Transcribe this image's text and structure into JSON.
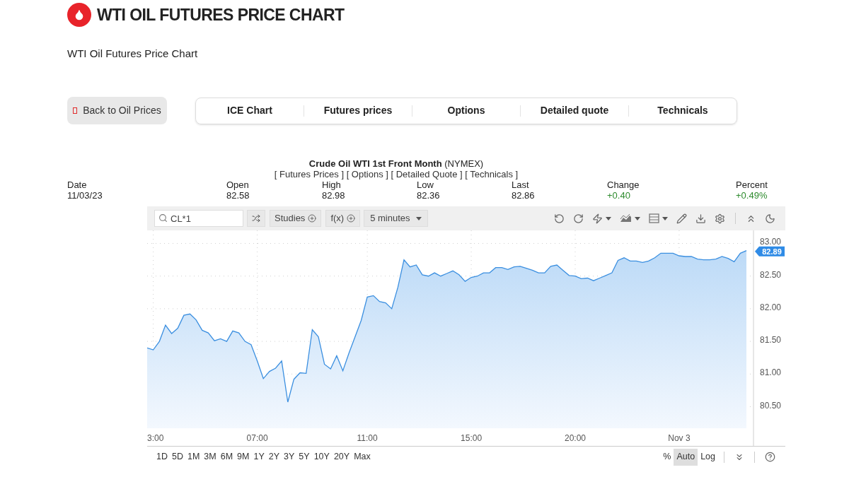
{
  "header": {
    "title": "WTI OIL FUTURES PRICE CHART",
    "subtitle": "WTI Oil Futures Price Chart"
  },
  "back_button": {
    "label": "Back to Oil Prices"
  },
  "nav": [
    "ICE Chart",
    "Futures prices",
    "Options",
    "Detailed quote",
    "Technicals"
  ],
  "quote": {
    "title": "**Crude Oil WTI 1st Front Month** (NYMEX)",
    "links": "[ Futures Prices ] [ Options ] [ Detailed Quote ] [ Technicals ]",
    "stats": [
      {
        "label": "Date",
        "value": "11/03/23"
      },
      {
        "label": "Open",
        "value": "82.58"
      },
      {
        "label": "High",
        "value": "82.98"
      },
      {
        "label": "Low",
        "value": "82.36"
      },
      {
        "label": "Last",
        "value": "82.86"
      },
      {
        "label": "Change",
        "value": "+0.40",
        "color": "#2e8b2e"
      },
      {
        "label": "Percent",
        "value": "+0.49%",
        "color": "#2e8b2e"
      }
    ]
  },
  "toolbar": {
    "search": {
      "value": "CL*1"
    },
    "studies": "Studies",
    "fx": "f(x)",
    "interval": "5 minutes"
  },
  "chart": {
    "last_price": "82.89",
    "chart_data": {
      "type": "area",
      "categories": [
        null,
        "3:00",
        null,
        null,
        null,
        null,
        null,
        null,
        null,
        null,
        null,
        null,
        null,
        null,
        null,
        null,
        null,
        null,
        "07:00",
        null,
        null,
        null,
        null,
        null,
        null,
        null,
        null,
        null,
        null,
        null,
        null,
        null,
        null,
        null,
        null,
        null,
        "11:00",
        null,
        null,
        null,
        null,
        null,
        null,
        null,
        null,
        null,
        null,
        null,
        null,
        null,
        null,
        null,
        null,
        "15:00",
        null,
        null,
        null,
        null,
        null,
        null,
        null,
        null,
        null,
        null,
        null,
        null,
        null,
        null,
        null,
        null,
        "20:00",
        null,
        null,
        null,
        null,
        null,
        null,
        null,
        null,
        null,
        null,
        null,
        null,
        null,
        null,
        null,
        null,
        "Nov 3",
        null,
        null,
        null,
        null,
        null,
        null,
        null,
        null,
        null,
        null,
        null
      ],
      "series": [
        {
          "color": "#3b8fe0",
          "values": [
            81.4,
            81.37,
            81.5,
            81.75,
            81.62,
            81.7,
            81.9,
            81.92,
            81.83,
            81.67,
            81.63,
            81.51,
            81.54,
            81.5,
            81.66,
            81.63,
            81.5,
            81.45,
            81.2,
            80.93,
            81.04,
            81.09,
            81.2,
            80.57,
            80.92,
            81.02,
            81.01,
            81.68,
            81.57,
            81.15,
            81.08,
            81.28,
            81.05,
            81.32,
            81.57,
            81.82,
            82.18,
            82.2,
            82.11,
            82.09,
            82.0,
            82.33,
            82.75,
            82.64,
            82.67,
            82.52,
            82.5,
            82.55,
            82.5,
            82.54,
            82.58,
            82.52,
            82.42,
            82.48,
            82.5,
            82.55,
            82.55,
            82.63,
            82.63,
            82.6,
            82.64,
            82.65,
            82.62,
            82.59,
            82.55,
            82.55,
            82.65,
            82.67,
            82.59,
            82.51,
            82.5,
            82.46,
            82.47,
            82.43,
            82.47,
            82.51,
            82.55,
            82.74,
            82.78,
            82.73,
            82.73,
            82.71,
            82.73,
            82.78,
            82.85,
            82.85,
            82.85,
            82.81,
            82.8,
            82.8,
            82.76,
            82.75,
            82.75,
            82.76,
            82.8,
            82.77,
            82.72,
            82.85,
            82.89
          ]
        }
      ],
      "ylim": [
        80.17,
        83.2
      ],
      "grid": true,
      "yticks": [
        {
          "value": 80.5,
          "label": "80.50"
        },
        {
          "value": 81,
          "label": "81.00"
        },
        {
          "value": 81.5,
          "label": "81.50"
        },
        {
          "value": 82,
          "label": "82.00"
        },
        {
          "value": 82.5,
          "label": "82.50"
        },
        {
          "value": 83,
          "label": "83.00"
        }
      ]
    }
  },
  "ranges": [
    "1D",
    "5D",
    "1M",
    "3M",
    "6M",
    "9M",
    "1Y",
    "2Y",
    "3Y",
    "5Y",
    "10Y",
    "20Y",
    "Max"
  ],
  "scale_options": [
    {
      "label": "%",
      "selected": false
    },
    {
      "label": "Auto",
      "selected": true
    },
    {
      "label": "Log",
      "selected": false
    }
  ]
}
